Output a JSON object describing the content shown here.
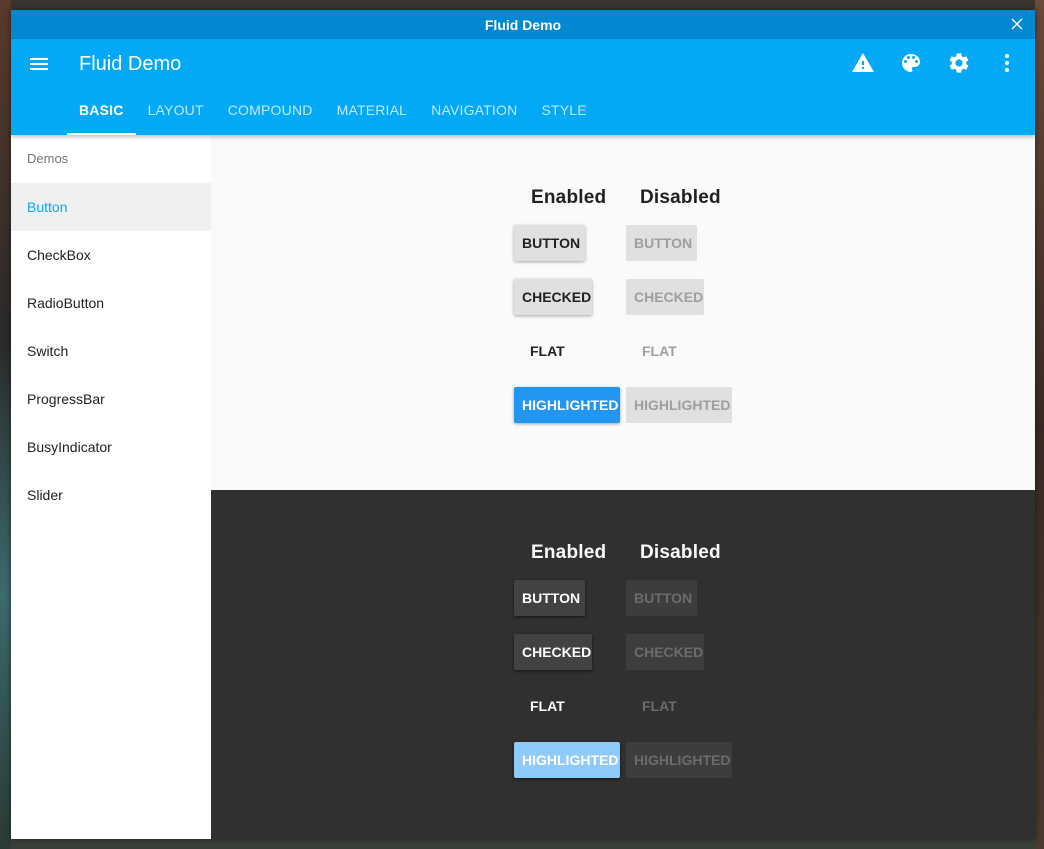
{
  "window": {
    "title": "Fluid Demo"
  },
  "appbar": {
    "title": "Fluid Demo",
    "actions": [
      "warning-icon",
      "palette-icon",
      "settings-icon",
      "more-vert-icon"
    ]
  },
  "tabs": [
    "BASIC",
    "LAYOUT",
    "COMPOUND",
    "MATERIAL",
    "NAVIGATION",
    "STYLE"
  ],
  "active_tab": "BASIC",
  "sidebar": {
    "header": "Demos",
    "items": [
      "Button",
      "CheckBox",
      "RadioButton",
      "Switch",
      "ProgressBar",
      "BusyIndicator",
      "Slider"
    ],
    "active": "Button"
  },
  "demo": {
    "enabled_header": "Enabled",
    "disabled_header": "Disabled",
    "button_label": "BUTTON",
    "checked_label": "CHECKED",
    "flat_label": "FLAT",
    "highlighted_label": "HIGHLIGHTED"
  },
  "colors": {
    "titlebar": "#0288d1",
    "appbar": "#03a9f4",
    "highlight_light": "#2196f3",
    "highlight_dark": "#90caf9",
    "dark_bg": "#303030"
  }
}
